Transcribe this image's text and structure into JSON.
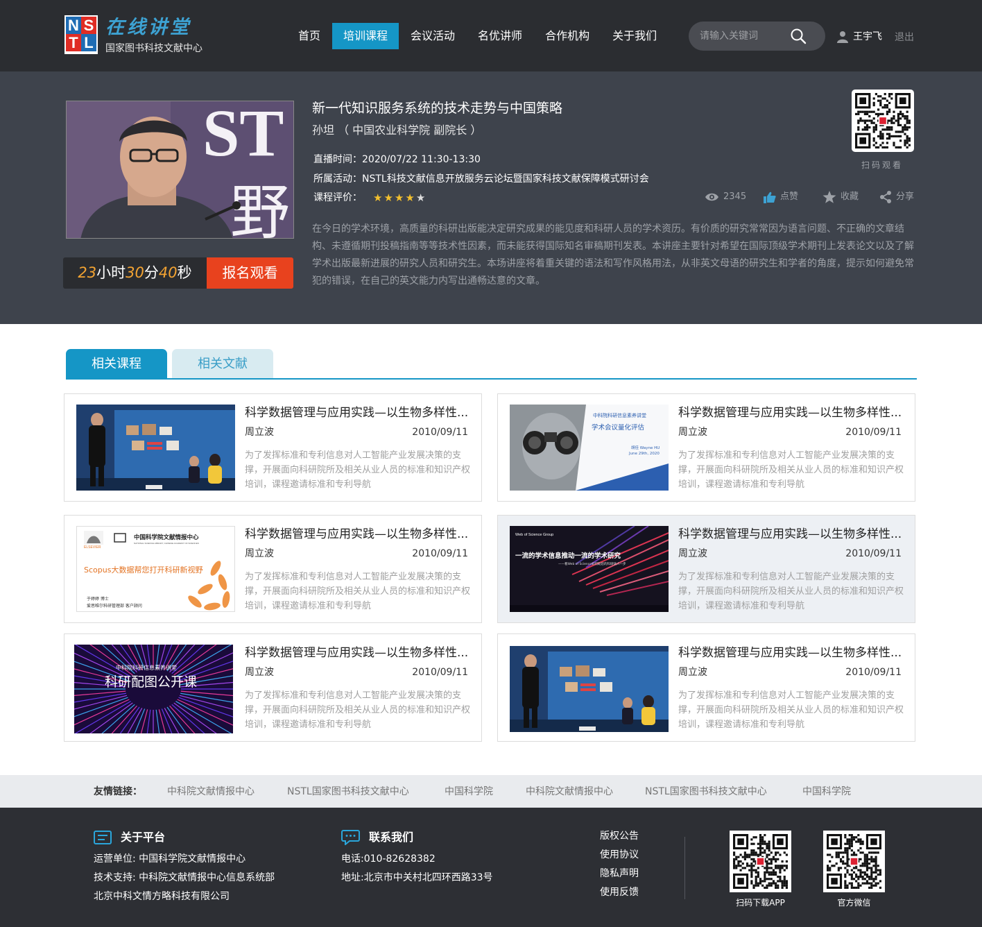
{
  "header": {
    "logo_letters": [
      "N",
      "S",
      "T",
      "L"
    ],
    "logo_title": "在线讲堂",
    "logo_subtitle": "国家图书科技文献中心",
    "nav": [
      "首页",
      "培训课程",
      "会议活动",
      "名优讲师",
      "合作机构",
      "关于我们"
    ],
    "nav_active": "培训课程",
    "search_placeholder": "请输入关键词",
    "user_name": "王宇飞",
    "logout": "退出"
  },
  "course": {
    "countdown": {
      "hours": "23",
      "h_unit": "小时",
      "minutes": "30",
      "m_unit": "分",
      "seconds": "40",
      "s_unit": "秒"
    },
    "signup": "报名观看",
    "video_text": "ST",
    "video_text2": "野",
    "title": "新一代知识服务系统的技术走势与中国策略",
    "speaker": "孙坦 （ 中国农业科学院  副院长 ）",
    "live_time": "直播时间：2020/07/22  11:30-13:30",
    "activity": "所属活动：NSTL科技文献信息开放服务云论坛暨国家科技文献保障模式研讨会",
    "rating_label": "课程评价：",
    "rating": 4,
    "rating_max": 5,
    "views": "2345",
    "like": "点赞",
    "favorite": "收藏",
    "share": "分享",
    "qr_label": "扫码观看",
    "description": "在今日的学术环境，高质量的科研出版能决定研究成果的能见度和科研人员的学术资历。有价质的研究常常因为语言问题、不正确的文章结构、未遵循期刊投稿指南等等技术性因素，而未能获得国际知名审稿期刊发表。本讲座主要针对希望在国际顶级学术期刊上发表论文以及了解学术出版最新进展的研究人员和研究生。本场讲座将着重关键的语法和写作风格用法，从非英文母语的研究生和学者的角度，提示如何避免常犯的错误，在自己的英文能力内写出通畅达意的文章。"
  },
  "tabs": [
    "相关课程",
    "相关文献"
  ],
  "cards": [
    {
      "title": "科学数据管理与应用实践—以生物多样性...",
      "author": "周立波",
      "date": "2010/09/11",
      "desc": "为了发挥标准和专利信息对人工智能产业发展决策的支撑，开展面向科研院所及相关从业人员的标准和知识产权培训，课程邀请标准和专利导航",
      "thumb": "studio"
    },
    {
      "title": "科学数据管理与应用实践—以生物多样性...",
      "author": "周立波",
      "date": "2010/09/11",
      "desc": "为了发挥标准和专利信息对人工智能产业发展决策的支撑，开展面向科研院所及相关从业人员的标准和知识产权培训，课程邀请标准和专利导航",
      "thumb": "binocular"
    },
    {
      "title": "科学数据管理与应用实践—以生物多样性...",
      "author": "周立波",
      "date": "2010/09/11",
      "desc": "为了发挥标准和专利信息对人工智能产业发展决策的支撑，开展面向科研院所及相关从业人员的标准和知识产权培训，课程邀请标准和专利导航",
      "thumb": "scopus"
    },
    {
      "title": "科学数据管理与应用实践—以生物多样性...",
      "author": "周立波",
      "date": "2010/09/11",
      "desc": "为了发挥标准和专利信息对人工智能产业发展决策的支撑，开展面向科研院所及相关从业人员的标准和知识产权培训，课程邀请标准和专利导航",
      "thumb": "wos"
    },
    {
      "title": "科学数据管理与应用实践—以生物多样性...",
      "author": "周立波",
      "date": "2010/09/11",
      "desc": "为了发挥标准和专利信息对人工智能产业发展决策的支撑，开展面向科研院所及相关从业人员的标准和知识产权培训，课程邀请标准和专利导航",
      "thumb": "figure"
    },
    {
      "title": "科学数据管理与应用实践—以生物多样性...",
      "author": "周立波",
      "date": "2010/09/11",
      "desc": "为了发挥标准和专利信息对人工智能产业发展决策的支撑，开展面向科研院所及相关从业人员的标准和知识产权培训，课程邀请标准和专利导航",
      "thumb": "studio"
    }
  ],
  "thumb_text": {
    "binocular_top": "中科院科研信息素养讲堂",
    "binocular_title": "学术会议量化评估",
    "binocular_author": "胡佳 Wayne HU",
    "binocular_date": "June 29th, 2020",
    "scopus_org": "中国科学院文献情报中心",
    "scopus_org_en": "NATIONAL SCIENCE LIBRARY, CHINESE ACADEMY OF SCIENCES",
    "scopus_brand": "ELSEVIER",
    "scopus_title_a": "Scopus",
    "scopus_title_b": "大数据帮您打开科研新视野",
    "scopus_person": "于婷婷 博士",
    "scopus_dept": "爱思唯尔科研管理部  客户顾问",
    "wos_brand": "Web of Science Group",
    "wos_title": "一流的学术信息推动一流的学术研究",
    "wos_sub": "——看Web of Science如何助您的科研快人一步",
    "figure_top": "中科院科研信息素养讲堂",
    "figure_title": "科研配图公开课"
  },
  "friend_links": {
    "label": "友情链接：",
    "items": [
      "中科院文献情报中心",
      "NSTL国家图书科技文献中心",
      "中国科学院",
      "中科院文献情报中心",
      "NSTL国家图书科技文献中心",
      "中国科学院"
    ]
  },
  "footer": {
    "about_title": "关于平台",
    "about_lines": [
      "运营单位: 中国科学院文献情报中心",
      "技术支持: 中科院文献情报中心信息系统部",
      "北京中科文情方略科技有限公司"
    ],
    "contact_title": "联系我们",
    "contact_lines": [
      "电话:010-82628382",
      "地址:北京市中关村北四环西路33号"
    ],
    "links": [
      "版权公告",
      "使用协议",
      "隐私声明",
      "使用反馈"
    ],
    "qr_app_label": "扫码下载APP",
    "qr_wechat_label": "官方微信"
  },
  "colors": {
    "accent": "#1596c6",
    "header_bg": "#2b2d31",
    "hero_bg": "#3e434c",
    "signup": "#e8421e",
    "countdown_num": "#f3a332",
    "star": "#f3c02e"
  }
}
